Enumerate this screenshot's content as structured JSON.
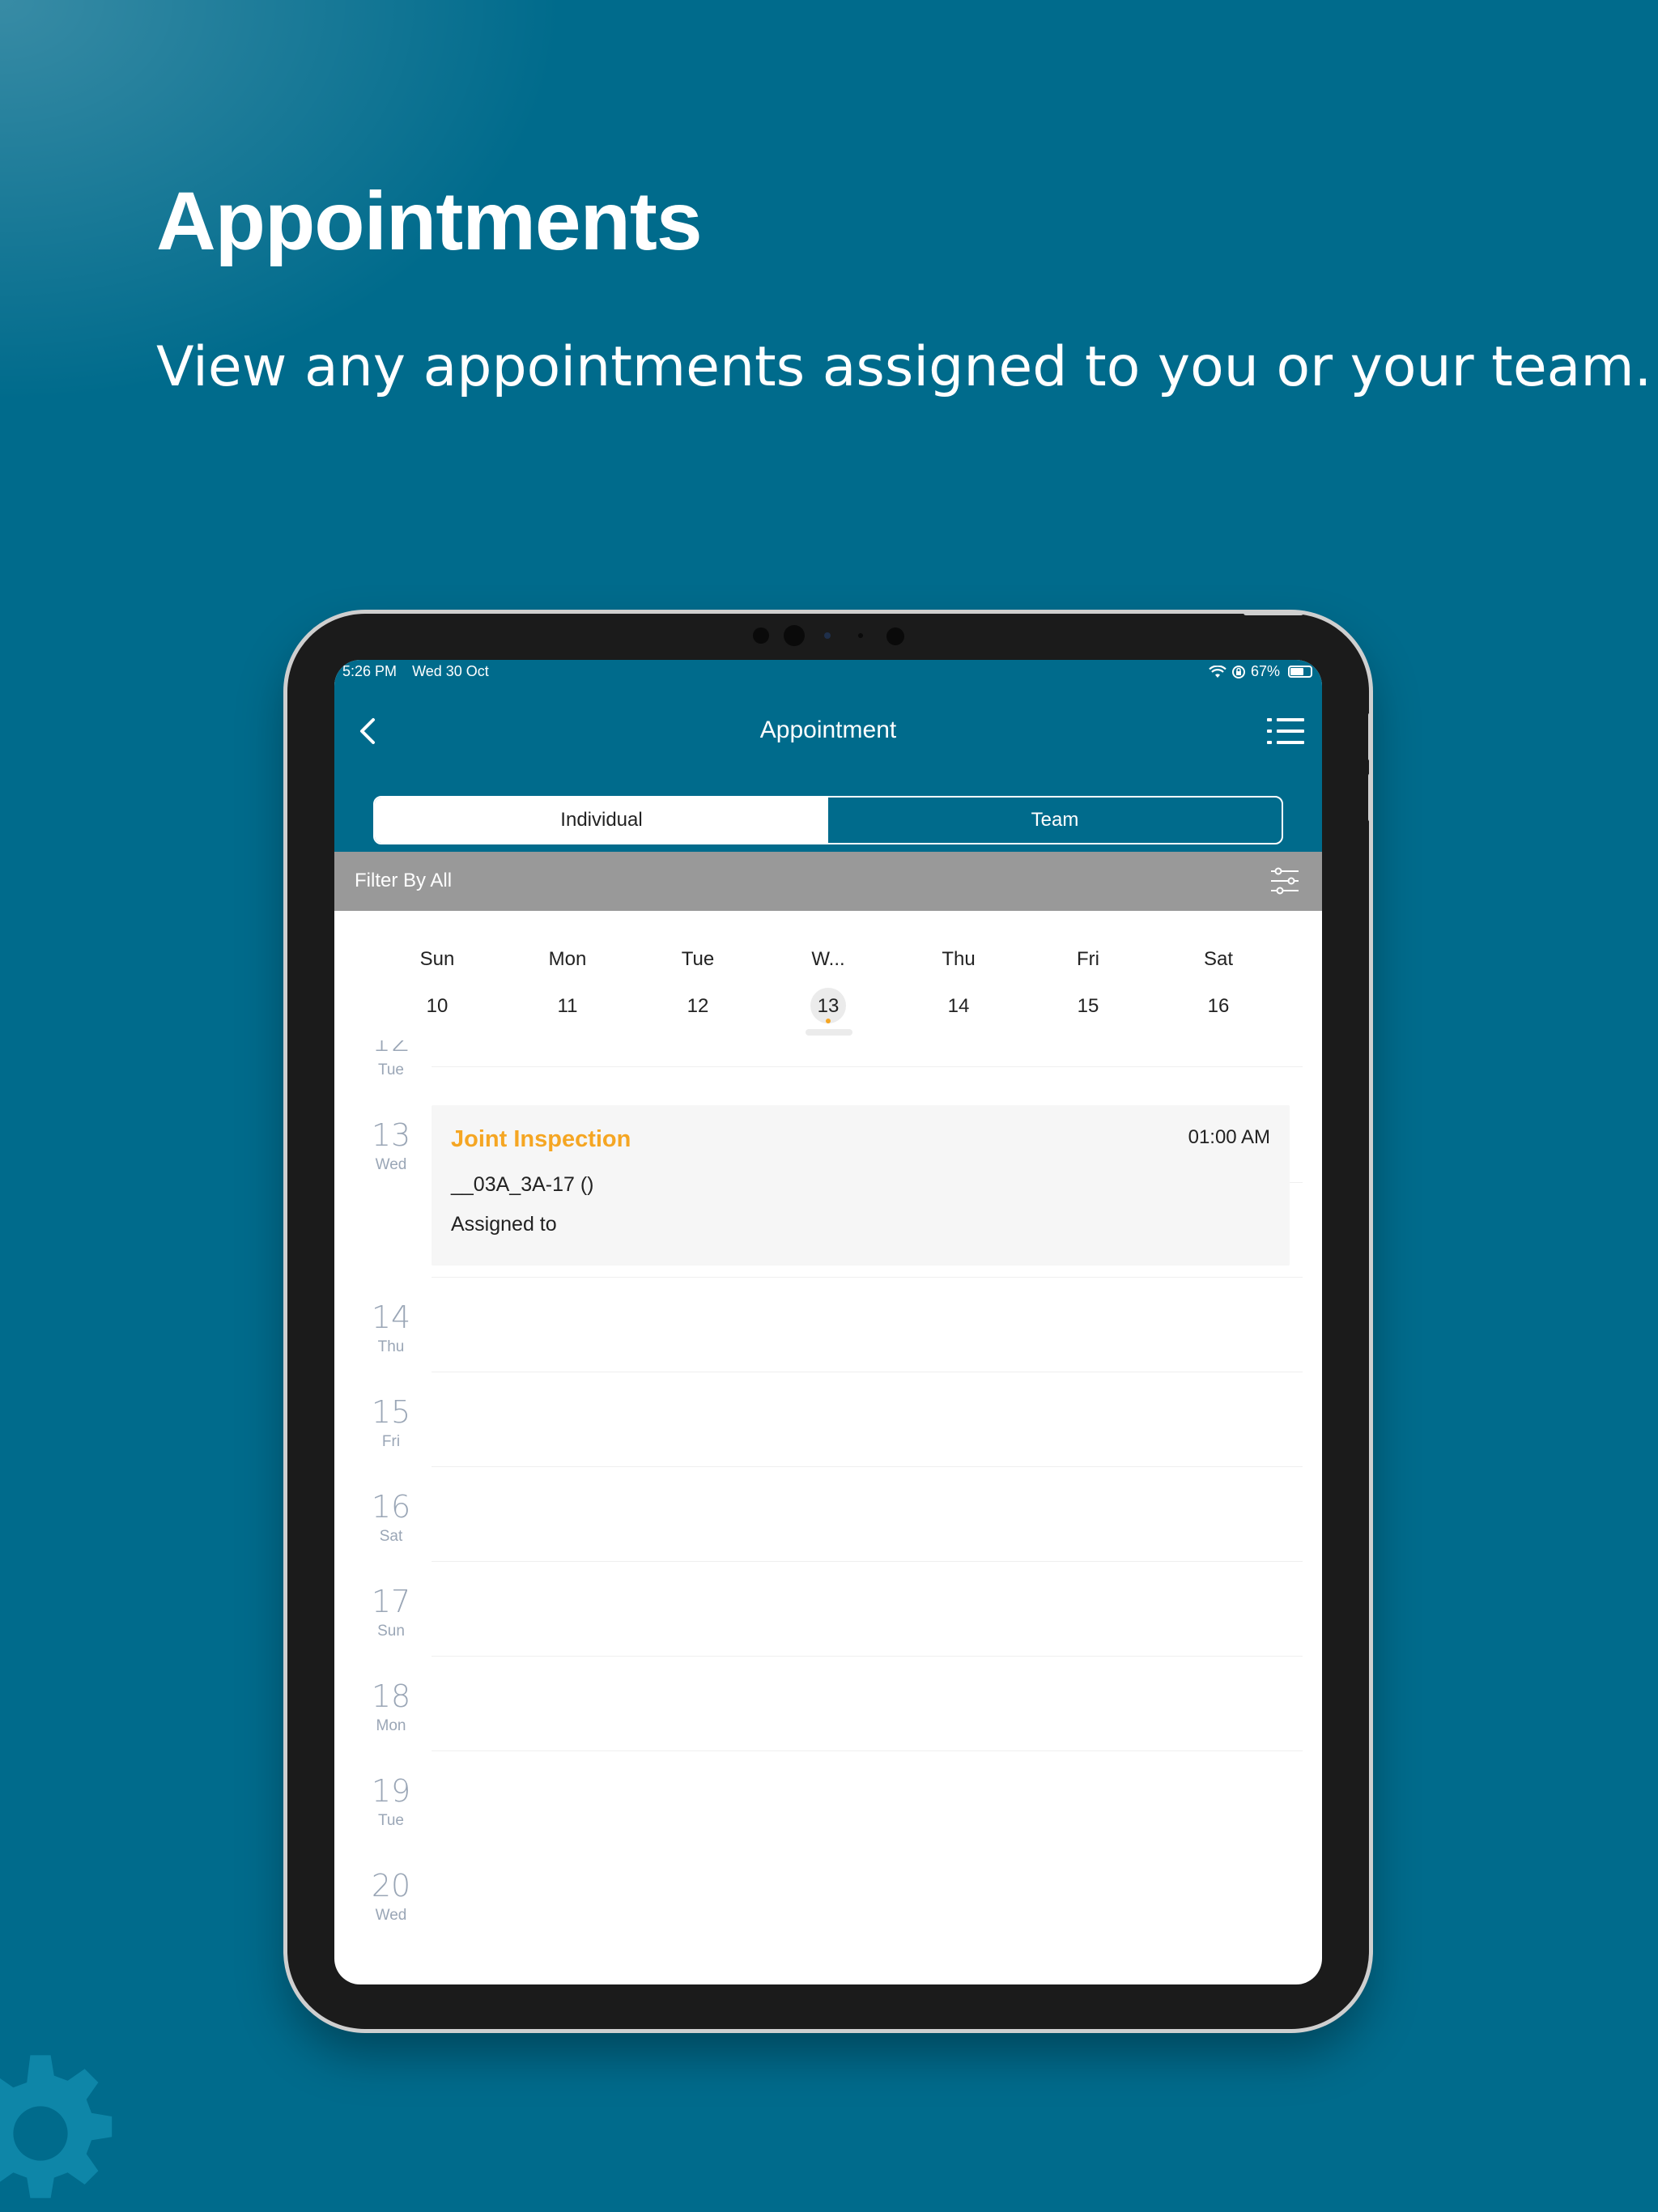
{
  "hero": {
    "title": "Appointments",
    "subtitle": "View any appointments assigned to you or your team."
  },
  "status_bar": {
    "time": "5:26 PM",
    "date": "Wed 30 Oct",
    "battery": "67%",
    "battery_level": 0.67
  },
  "nav": {
    "title": "Appointment",
    "back_icon": "chevron-left-icon",
    "menu_icon": "list-icon"
  },
  "segments": {
    "individual": "Individual",
    "team": "Team",
    "selected": "Individual"
  },
  "filter": {
    "label": "Filter By All",
    "icon": "sliders-icon"
  },
  "week": {
    "days": [
      {
        "wd": "Sun",
        "num": "10"
      },
      {
        "wd": "Mon",
        "num": "11"
      },
      {
        "wd": "Tue",
        "num": "12"
      },
      {
        "wd": "W...",
        "num": "13"
      },
      {
        "wd": "Thu",
        "num": "14"
      },
      {
        "wd": "Fri",
        "num": "15"
      },
      {
        "wd": "Sat",
        "num": "16"
      }
    ],
    "selected_index": 3
  },
  "agenda": {
    "days": [
      {
        "num": "12",
        "wd": "Tue"
      },
      {
        "num": "13",
        "wd": "Wed"
      },
      {
        "num": "14",
        "wd": "Thu"
      },
      {
        "num": "15",
        "wd": "Fri"
      },
      {
        "num": "16",
        "wd": "Sat"
      },
      {
        "num": "17",
        "wd": "Sun"
      },
      {
        "num": "18",
        "wd": "Mon"
      },
      {
        "num": "19",
        "wd": "Tue"
      },
      {
        "num": "20",
        "wd": "Wed"
      }
    ],
    "appointment": {
      "title": "Joint Inspection",
      "time": "01:00 AM",
      "unit": "__03A_3A-17 ()",
      "assigned": "Assigned to"
    }
  },
  "colors": {
    "brand": "#006b8c",
    "accent": "#f5a623",
    "filter_bar": "#999999"
  }
}
